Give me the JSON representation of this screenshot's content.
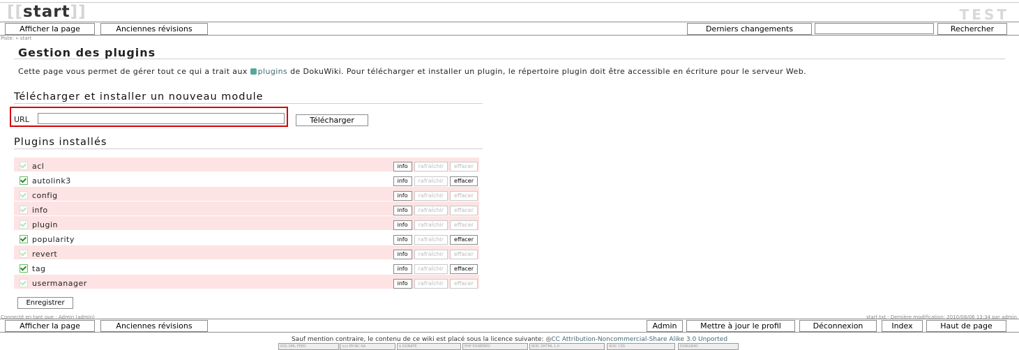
{
  "header": {
    "page_id": "start",
    "wiki_name": "TEST",
    "breadcrumb": "Piste: » start"
  },
  "top_toolbar": {
    "show_page": "Afficher la page",
    "old_revisions": "Anciennes révisions",
    "recent_changes": "Derniers changements",
    "search_value": "",
    "search_button": "Rechercher"
  },
  "main": {
    "title": "Gestion des plugins",
    "description_before": "Cette page vous permet de gérer tout ce qui a trait aux ",
    "description_link": "plugins",
    "description_after": " de DokuWiki. Pour télécharger et installer un plugin, le répertoire plugin doit être accessible en écriture pour le serveur Web.",
    "download_section_title": "Télécharger et installer un nouveau module",
    "url_label": "URL",
    "url_value": "",
    "download_button": "Télécharger",
    "installed_section_title": "Plugins installés",
    "action_labels": {
      "info": "info",
      "refresh": "rafraîchir",
      "delete": "effacer"
    },
    "plugins": [
      {
        "name": "acl",
        "enabled": false,
        "protected": true
      },
      {
        "name": "autolink3",
        "enabled": true,
        "protected": false
      },
      {
        "name": "config",
        "enabled": false,
        "protected": true
      },
      {
        "name": "info",
        "enabled": false,
        "protected": true
      },
      {
        "name": "plugin",
        "enabled": false,
        "protected": true
      },
      {
        "name": "popularity",
        "enabled": true,
        "protected": false
      },
      {
        "name": "revert",
        "enabled": false,
        "protected": true
      },
      {
        "name": "tag",
        "enabled": true,
        "protected": false
      },
      {
        "name": "usermanager",
        "enabled": false,
        "protected": true
      }
    ],
    "save_button": "Enregistrer"
  },
  "status": {
    "logged_in": "Connecté en tant que : Admin (admin)",
    "last_modified": "start.txt · Dernière modification: 2010/08/06 13:34 par admin"
  },
  "bottom_toolbar": {
    "show_page": "Afficher la page",
    "old_revisions": "Anciennes révisions",
    "admin": "Admin",
    "update_profile": "Mettre à jour le profil",
    "logout": "Déconnexion",
    "index": "Index",
    "top_of_page": "Haut de page"
  },
  "license": {
    "text": "Sauf mention contraire, le contenu de ce wiki est placé sous la licence suivante: ",
    "link": "CC Attribution-Noncommercial-Share Alike 3.0 Unported"
  },
  "badges": [
    "RSS XML FEED",
    "(cc) BY-NC-SA",
    "$ DONATE",
    "PHP POWERED",
    "W3C XHTML 1.0",
    "W3C CSS",
    "DOKUWIKI"
  ],
  "colors": {
    "disabled_row": "#fde3e3",
    "highlight_box": "#d40000",
    "link": "#436976"
  }
}
